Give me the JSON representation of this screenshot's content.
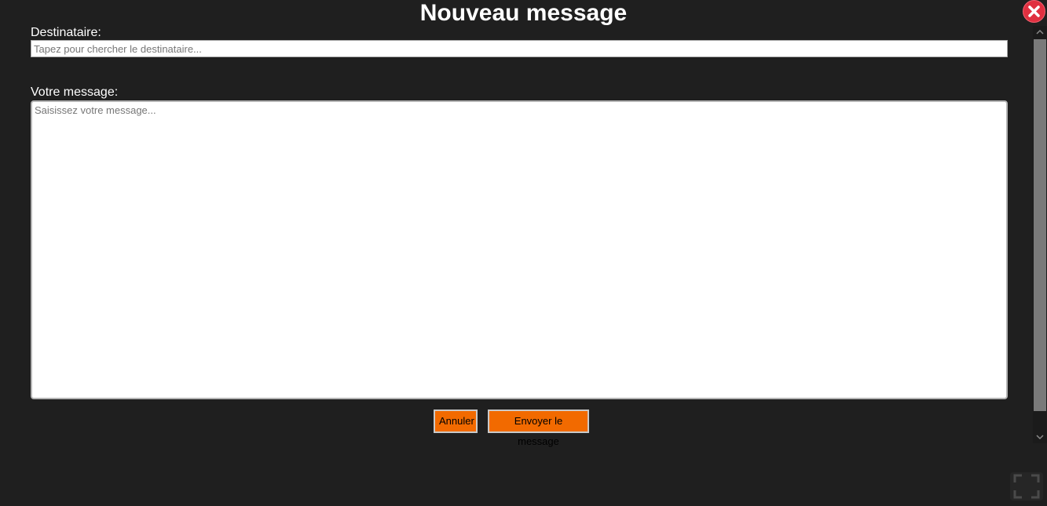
{
  "dialog": {
    "title": "Nouveau message",
    "close_icon": "close-icon"
  },
  "form": {
    "recipient_label": "Destinataire:",
    "recipient_placeholder": "Tapez pour chercher le destinataire...",
    "recipient_value": "",
    "message_label": "Votre message:",
    "message_placeholder": "Saisissez votre message...",
    "message_value": ""
  },
  "actions": {
    "cancel_label": "Annuler",
    "send_label": "Envoyer le message"
  },
  "scrollbar": {
    "up_icon": "chevron-up-icon",
    "down_icon": "chevron-down-icon"
  },
  "fullscreen": {
    "icon": "fullscreen-icon"
  },
  "colors": {
    "background": "#1f1f1f",
    "button_accent": "#f26a00",
    "close_button": "#e03040",
    "text": "#ffffff"
  }
}
